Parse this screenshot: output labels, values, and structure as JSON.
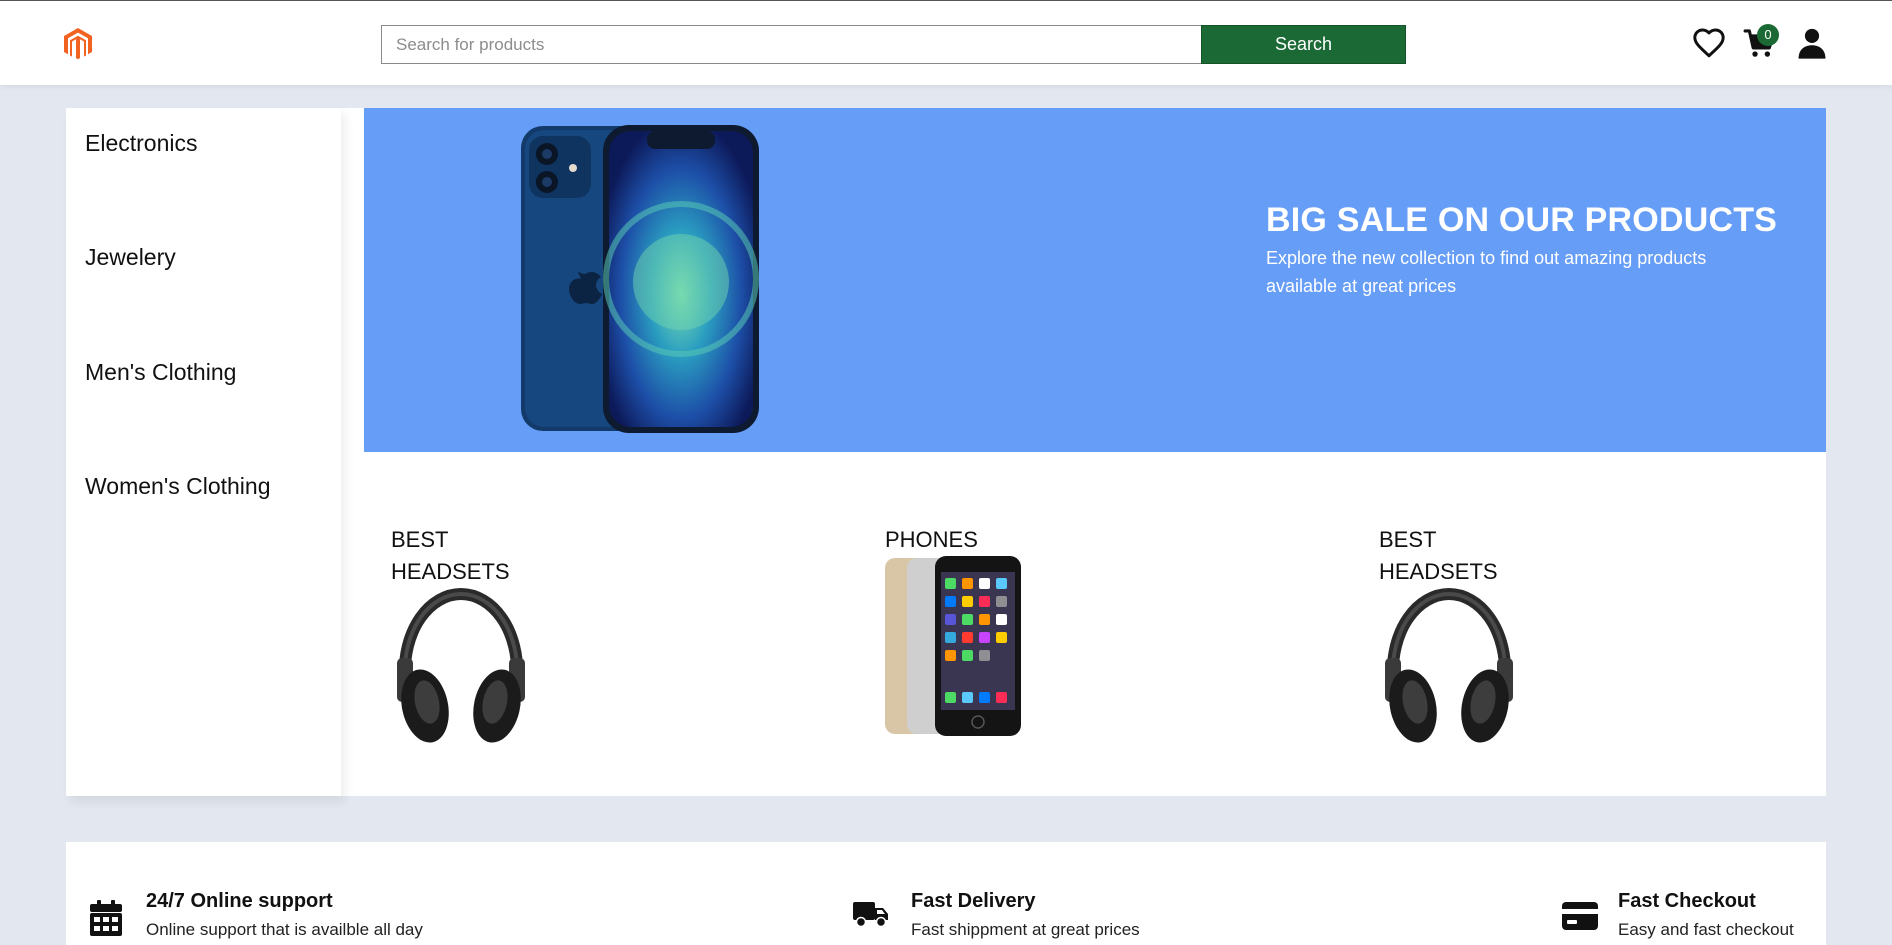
{
  "header": {
    "logo_icon": "magento-logo-icon",
    "search": {
      "placeholder": "Search for products",
      "value": "",
      "button_label": "Search"
    },
    "icons": [
      "heart-icon",
      "cart-icon",
      "user-icon"
    ],
    "cart_count": "0"
  },
  "sidebar": {
    "categories": [
      {
        "label": "Electronics"
      },
      {
        "label": "Jewelery"
      },
      {
        "label": "Men's Clothing"
      },
      {
        "label": "Women's Clothing"
      }
    ]
  },
  "banner": {
    "title": "BIG SALE ON OUR PRODUCTS",
    "subtitle": "Explore the new collection to find out amazing products available at great prices",
    "image": "iphone-12-image",
    "background": "#669df6"
  },
  "promo_tiles": [
    {
      "line1": "BEST",
      "line2": "HEADSETS",
      "image": "headphones-image"
    },
    {
      "line1": "PHONES",
      "line2": "",
      "image": "iphone-6-image"
    },
    {
      "line1": "BEST",
      "line2": "HEADSETS",
      "image": "headphones-image"
    }
  ],
  "features": [
    {
      "title": "24/7 Online support",
      "desc": "Online support that is availble all day",
      "icon": "calendar-icon"
    },
    {
      "title": "Fast Delivery",
      "desc": "Fast shippment at great prices",
      "icon": "truck-icon"
    },
    {
      "title": "Fast Checkout",
      "desc": "Easy and fast checkout",
      "icon": "credit-card-icon"
    }
  ],
  "colors": {
    "accent": "#1b6a35",
    "page_bg": "#e3e8f0",
    "logo": "#f26322"
  }
}
